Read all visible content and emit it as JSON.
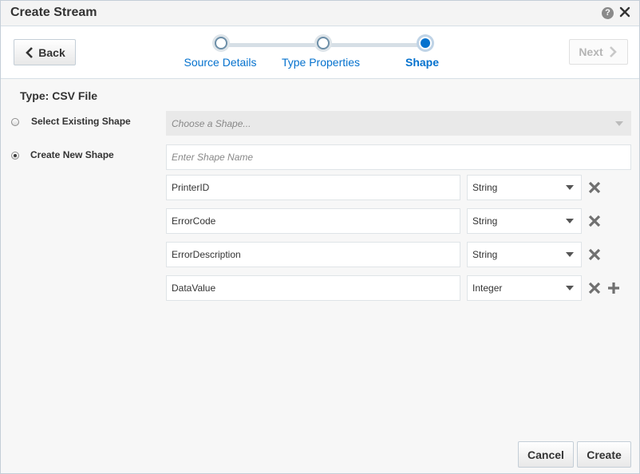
{
  "dialog": {
    "title": "Create Stream",
    "help_icon": "help-icon",
    "close_icon": "close-icon"
  },
  "train": {
    "back_label": "Back",
    "next_label": "Next",
    "stops": [
      {
        "label": "Source Details",
        "state": "visited"
      },
      {
        "label": "Type Properties",
        "state": "visited"
      },
      {
        "label": "Shape",
        "state": "current"
      }
    ]
  },
  "form": {
    "type_label": "Type:",
    "type_value": "CSV File",
    "existing_option": "Select Existing Shape",
    "existing_placeholder": "Choose a Shape...",
    "new_option": "Create New Shape",
    "shape_name_placeholder": "Enter Shape Name",
    "selected_option": "Create New Shape",
    "fields": [
      {
        "name": "PrinterID",
        "type": "String"
      },
      {
        "name": "ErrorCode",
        "type": "String"
      },
      {
        "name": "ErrorDescription",
        "type": "String"
      },
      {
        "name": "DataValue",
        "type": "Integer"
      }
    ]
  },
  "footer": {
    "cancel_label": "Cancel",
    "create_label": "Create"
  },
  "colors": {
    "accent": "#0572ce",
    "border": "#c4ced7"
  }
}
